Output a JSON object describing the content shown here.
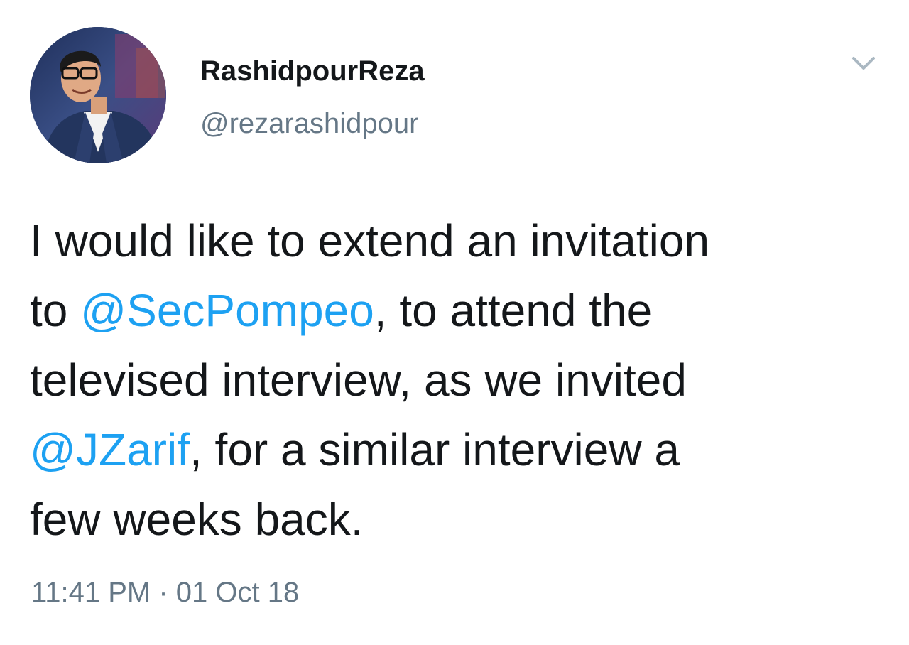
{
  "tweet": {
    "author": {
      "display_name": "RashidpourReza",
      "handle": "@rezarashidpour"
    },
    "menu_icon": "chevron-down-icon",
    "text": {
      "line1": "I would like to extend an invitation",
      "line2_prefix": "to ",
      "mention1": "@SecPompeo",
      "line2_suffix": ", to attend the",
      "line3": "televised interview, as we invited",
      "mention2": "@JZarif",
      "line4_suffix": ", for a similar interview a",
      "line5": "few weeks back."
    },
    "timestamp": "11:41 PM · 01 Oct 18"
  },
  "colors": {
    "mention": "#1da1f2",
    "secondary_text": "#657786",
    "primary_text": "#14171a"
  }
}
